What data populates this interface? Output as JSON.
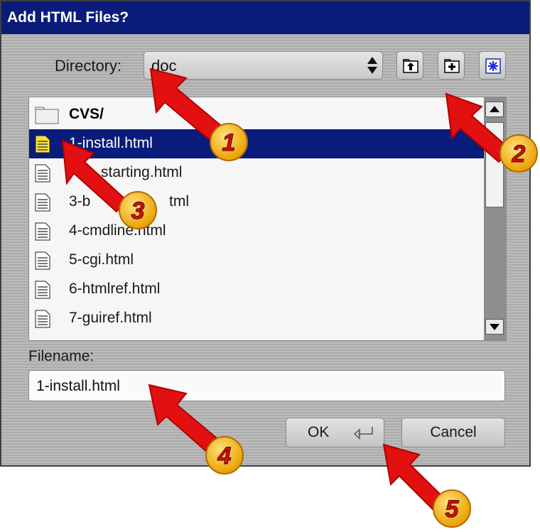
{
  "dialog": {
    "title": "Add HTML Files?",
    "directory_label": "Directory:",
    "directory_value": "doc",
    "files": [
      {
        "name": "CVS/",
        "type": "folder",
        "selected": false
      },
      {
        "name": "1-install.html",
        "type": "file",
        "selected": true
      },
      {
        "name": "starting.html",
        "type": "file",
        "selected": false
      },
      {
        "name": "3-b",
        "name_tail": "tml",
        "type": "file",
        "selected": false
      },
      {
        "name": "4-cmdline.html",
        "type": "file",
        "selected": false
      },
      {
        "name": "5-cgi.html",
        "type": "file",
        "selected": false
      },
      {
        "name": "6-htmlref.html",
        "type": "file",
        "selected": false
      },
      {
        "name": "7-guiref.html",
        "type": "file",
        "selected": false
      }
    ],
    "filename_label": "Filename:",
    "filename_value": "1-install.html",
    "ok_label": "OK",
    "cancel_label": "Cancel"
  },
  "callouts": [
    "1",
    "2",
    "3",
    "4",
    "5"
  ],
  "icons": {
    "parent_dir": "folder-up-icon",
    "new_folder": "new-folder-icon",
    "bookmark": "bookmark-icon",
    "enter": "enter-key-icon"
  },
  "colors": {
    "title_bar": "#0a1c7a",
    "selection": "#0a1c7a",
    "callout_arrow": "#e01010",
    "callout_badge": "#f0b000"
  }
}
